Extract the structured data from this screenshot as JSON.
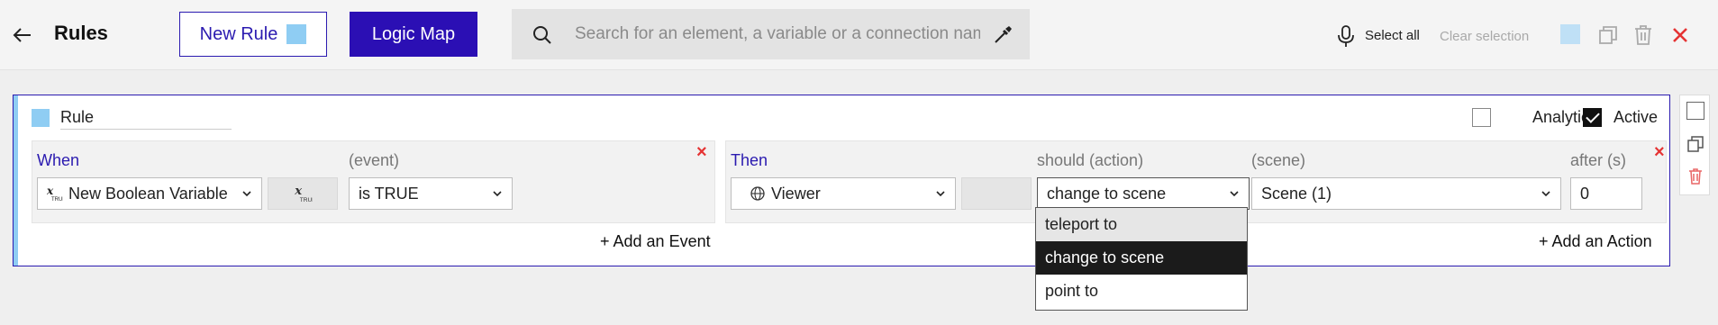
{
  "header": {
    "title": "Rules",
    "new_rule_label": "New Rule",
    "logic_map_label": "Logic Map",
    "search_placeholder": "Search for an element, a variable or a connection name",
    "select_all": "Select all",
    "clear_selection": "Clear selection",
    "accent_color": "#2b0fb4",
    "rule_swatch_color": "#8fcdf3"
  },
  "rule": {
    "name": "Rule",
    "analytics_label": "Analytics",
    "analytics_checked": false,
    "active_label": "Active",
    "active_checked": true,
    "when": {
      "label": "When",
      "variable": "New Boolean Variable",
      "variable_icon": "boolean-variable-icon",
      "event_label": "(event)",
      "event_value": "is TRUE",
      "add_label": "+ Add an Event"
    },
    "then": {
      "label": "Then",
      "target": "Viewer",
      "target_icon": "viewer-icon",
      "action_label": "should (action)",
      "action_value": "change to scene",
      "scene_label": "(scene)",
      "scene_value": "Scene (1)",
      "after_label": "after (s)",
      "after_value": "0",
      "add_label": "+ Add an Action"
    },
    "action_options": [
      "teleport to",
      "change to scene",
      "point to"
    ],
    "hovered_option": "teleport to"
  }
}
